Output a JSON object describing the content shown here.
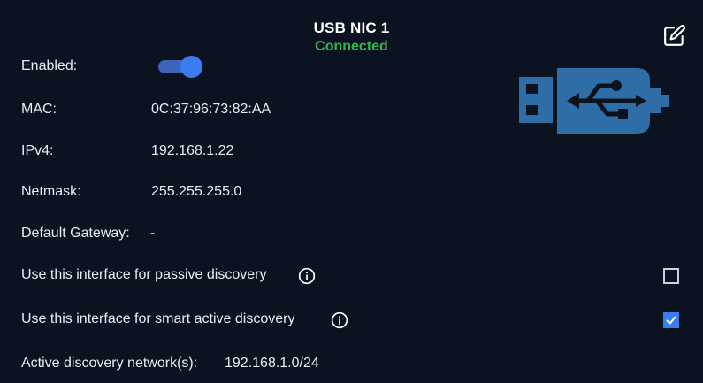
{
  "header": {
    "title": "USB NIC 1",
    "status": "Connected",
    "edit_icon": "edit-icon"
  },
  "colors": {
    "background": "#0b1220",
    "status_connected": "#2fb84a",
    "accent": "#3b7cf0",
    "usb_icon": "#2f6da6"
  },
  "fields": {
    "enabled_label": "Enabled:",
    "enabled": true,
    "mac_label": "MAC:",
    "mac_value": "0C:37:96:73:82:AA",
    "ipv4_label": "IPv4:",
    "ipv4_value": "192.168.1.22",
    "netmask_label": "Netmask:",
    "netmask_value": "255.255.255.0",
    "gateway_label": "Default Gateway:",
    "gateway_value": "-"
  },
  "options": {
    "passive_label": "Use this interface for passive discovery",
    "passive_checked": false,
    "smart_label": "Use this interface for smart active discovery",
    "smart_checked": true
  },
  "networks": {
    "label": "Active discovery network(s):",
    "value": "192.168.1.0/24"
  },
  "illustration": {
    "icon": "usb-drive-icon"
  }
}
